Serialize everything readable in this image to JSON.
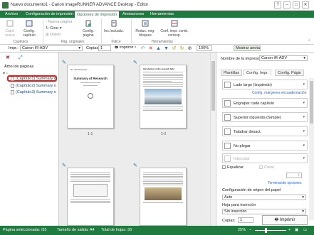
{
  "window": {
    "title": "Nuevo documento1 - Canon imageRUNNER ADVANCE Desktop - Editor",
    "controls": [
      "?",
      "–",
      "□",
      "✕"
    ]
  },
  "ribbon": {
    "tabs": [
      "Archivo",
      "Configuración de impresión",
      "Opciones de impresión",
      "Anotaciones",
      "Herramientas"
    ],
    "active_tab": "Opciones de impresión",
    "buttons": {
      "capitulo_nuevo": "Capít. nuevo",
      "config_capitulo": "Config. capítulo",
      "nueva_pagina": "Nueva página",
      "girar": "Girar",
      "dividir": "Dividir",
      "config_pagina": "Config. página",
      "ins_actualiz": "Ins./actualiz.",
      "reduc_mrg_bloques": "Reduc. mrg. bloques",
      "conf_impr_comb": "Conf. impr. comb. corresp."
    },
    "groups": [
      "Capítulos",
      "Pág. originales",
      "Índice",
      "Herramientas"
    ]
  },
  "toolbar": {
    "impr_label": "Impr.:",
    "printer": "Canon iR-ADV",
    "copies_label": "Copias:",
    "copies": "1",
    "print_btn": "Imprimir",
    "zoom": "100%",
    "mostrar_anotac": "Mostrar anotac."
  },
  "left": {
    "tree_title": "Árbol de páginas",
    "items": [
      "(Capítulo1) Summary o",
      "(Capítulo2) Summary o",
      "(Capítulo3) Summary o"
    ]
  },
  "pages": {
    "labels": [
      "1-1",
      "1-2"
    ],
    "p1_title": "Summary of Research",
    "p1_header": "No. 03 December",
    "p2_header": "Introduction of the research field"
  },
  "right": {
    "printer_label": "Nombre de la impresora:",
    "printer": "Canon iR-ADV",
    "tabs": [
      "Plantillas",
      "Config. Impr.",
      "Config. Págin"
    ],
    "settings": [
      "Lado largo (Izquierdo)",
      "Engrapar cada capítulo",
      "Superior izquierda (Simple)",
      "Taladrar desact.",
      "No plegar",
      "Intercalar"
    ],
    "link_margins": "Config. márgenes encuadernación",
    "equalizar": "Equalizar",
    "crear": "Crear",
    "stepper": "1",
    "link_finishing": "Terminando opciones",
    "origin_label": "Configuración de origen del papel",
    "origin_value": "Auto",
    "insert_label": "Hoja para inserción",
    "insert_value": "Sin inserción",
    "copies_label": "Copias:",
    "copies": "1",
    "print_btn": "Imprimir"
  },
  "status": {
    "selected": "Página seleccionada: /33",
    "output_size": "Tamaño de salida: A4",
    "total": "Total de hojas: 33",
    "zoom": "25%"
  },
  "colors": {
    "brand_green": "#1f7a3f",
    "highlight_red": "#e21b1b",
    "link_blue": "#2a64c8"
  }
}
